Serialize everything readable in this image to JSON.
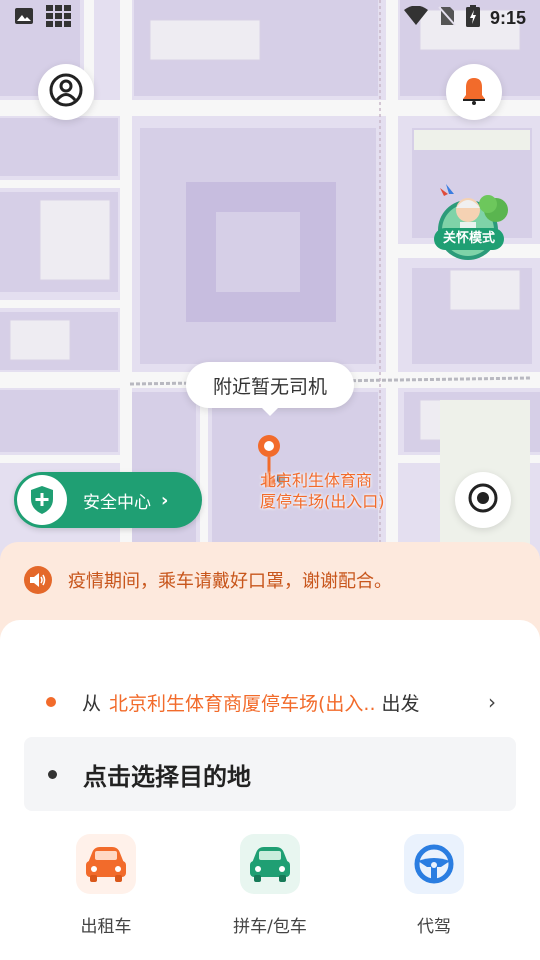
{
  "status_bar": {
    "time": "9:15"
  },
  "map": {
    "care_mode_label": "关怀模式",
    "driver_bubble": "附近暂无司机",
    "pickup_label_line1": "北京利生体育商",
    "pickup_label_line2": "厦停车场(出入口)",
    "safety_center_label": "安全中心",
    "safety_center_chevron": "›"
  },
  "notice": {
    "text": "疫情期间，乘车请戴好口罩，谢谢配合。"
  },
  "trip": {
    "from_prefix": "从",
    "from_place": "北京利生体育商厦停车场(出入..",
    "from_suffix": "出发",
    "from_arrow": "›",
    "destination_placeholder": "点击选择目的地"
  },
  "services": [
    {
      "label": "出租车",
      "icon": "taxi-car-icon",
      "color": "#f26b2b",
      "bg": "#fff1ea"
    },
    {
      "label": "拼车/包车",
      "icon": "carpool-car-icon",
      "color": "#1f9f73",
      "bg": "#e8f6f0"
    },
    {
      "label": "代驾",
      "icon": "steering-wheel-icon",
      "color": "#2a7de1",
      "bg": "#eaf2fd"
    }
  ],
  "colors": {
    "accent_orange": "#f26b2b",
    "accent_green": "#1f9f73",
    "accent_blue": "#2a7de1"
  }
}
